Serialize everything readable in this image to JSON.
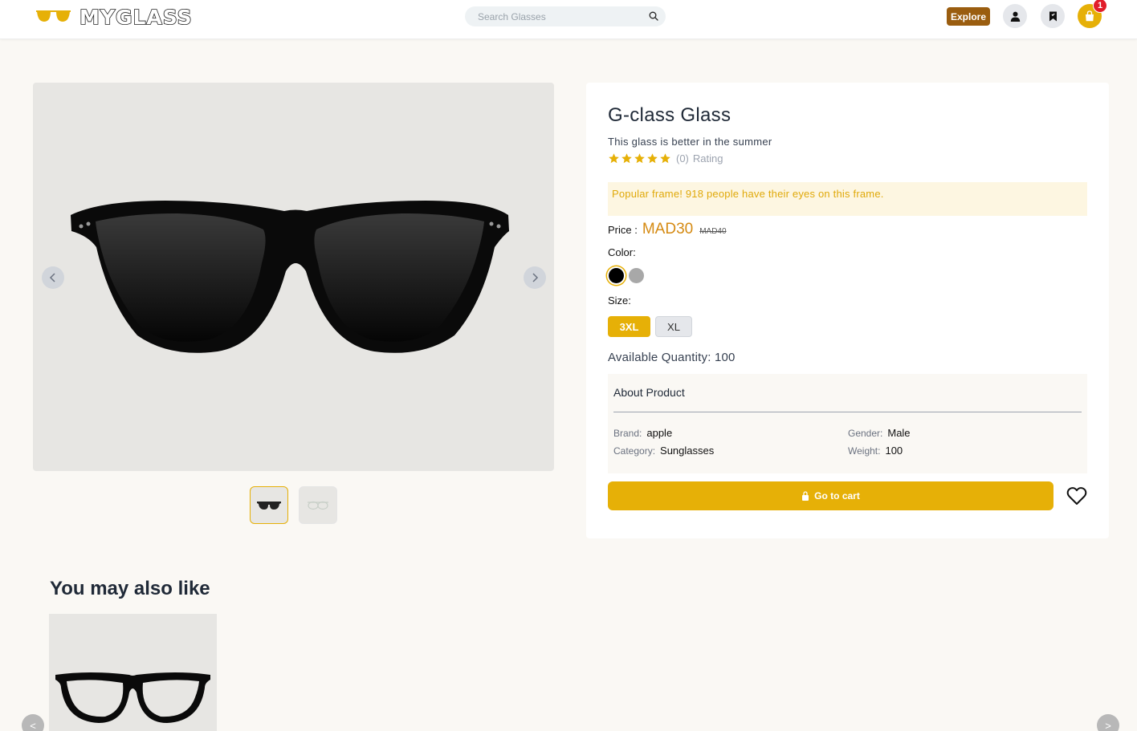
{
  "header": {
    "brand": "MYGLASS",
    "search_placeholder": "Search Glasses",
    "explore_label": "Explore",
    "cart_count": "1",
    "icons": [
      "search-icon",
      "user-icon",
      "bookmark-icon",
      "shopping-bag-icon"
    ]
  },
  "product": {
    "title": "G-class Glass",
    "subtitle": "This glass is better in the summer",
    "rating_count": "(0)",
    "rating_label": "Rating",
    "stars": 5,
    "popular_note": "Popular frame! 918 people have their eyes on this frame.",
    "price_label": "Price :",
    "price": "MAD30",
    "old_price": "MAD40",
    "color_label": "Color:",
    "colors": [
      "#000000",
      "#a8a8a8"
    ],
    "selected_color": "#000000",
    "size_label": "Size:",
    "sizes": [
      "3XL",
      "XL"
    ],
    "selected_size": "3XL",
    "quantity": "Available Quantity: 100"
  },
  "about": {
    "title": "About Product",
    "brand_label": "Brand:",
    "brand_value": "apple",
    "category_label": "Category:",
    "category_value": "Sunglasses",
    "gender_label": "Gender:",
    "gender_value": "Male",
    "weight_label": "Weight:",
    "weight_value": "100"
  },
  "actions": {
    "cart_button": "Go to cart"
  },
  "related": {
    "title": "You may also like",
    "prev": "<",
    "next": ">"
  },
  "colors": {
    "accent": "#e6b007",
    "explore": "#9a5d0f",
    "price": "#d58a12",
    "badge": "#e11d2a"
  }
}
